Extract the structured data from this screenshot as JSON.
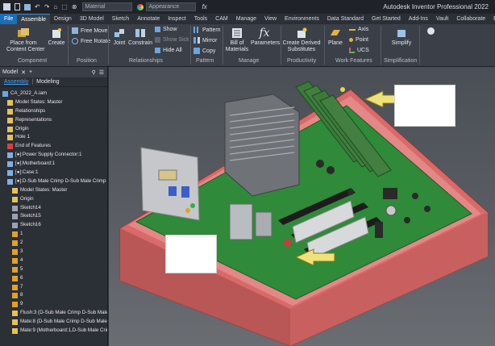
{
  "app": {
    "title": "Autodesk Inventor Professional 2022",
    "material_placeholder": "Material",
    "appearance_placeholder": "Appearance"
  },
  "tabs": [
    "File",
    "Assemble",
    "Design",
    "3D Model",
    "Sketch",
    "Annotate",
    "Inspect",
    "Tools",
    "CAM",
    "Manage",
    "View",
    "Environments",
    "Data Standard",
    "Get Started",
    "Add-Ins",
    "Vault",
    "Collaborate",
    "Ele"
  ],
  "ribbon": {
    "component": {
      "label": "Component",
      "place": "Place from\nContent Center",
      "create": "Create"
    },
    "position": {
      "label": "Position",
      "free_move": "Free Move",
      "free_rotate": "Free Rotate"
    },
    "relationships": {
      "label": "Relationships",
      "joint": "Joint",
      "constrain": "Constrain",
      "show": "Show",
      "show_sick": "Show Sick",
      "hide_all": "Hide All"
    },
    "pattern": {
      "label": "Pattern",
      "pattern": "Pattern",
      "mirror": "Mirror",
      "copy": "Copy"
    },
    "manage": {
      "label": "Manage",
      "bom": "Bill of\nMaterials",
      "parameters": "Parameters"
    },
    "productivity": {
      "label": "Productivity",
      "create_derived": "Create Derived\nSubstitutes"
    },
    "work_features": {
      "label": "Work Features",
      "plane": "Plane",
      "axis": "Axis",
      "point": "Point",
      "ucs": "UCS"
    },
    "simplification": {
      "label": "Simplification",
      "simplify": "Simplify"
    }
  },
  "browser": {
    "tab_model": "Model",
    "subtab_assembly": "Assembly",
    "subtab_modeling": "Modeling",
    "items": [
      "CA_2022_A.iam",
      "Model States: Master",
      "Relationships",
      "Representations",
      "Origin",
      "Hole 1",
      "End of Features",
      "[●]:Power Supply Connector:1",
      "[●]:Motherboard:1",
      "[●]:Case:1",
      "[●]:D-Sub Male Crimp D-Sub Male Crimp 9",
      "Model States: Master",
      "Origin",
      "Sketch14",
      "Sketch15",
      "Sketch16",
      "1",
      "2",
      "3",
      "4",
      "5",
      "6",
      "7",
      "8",
      "9",
      "Flush:3 (D-Sub Male Crimp D-Sub Male",
      "Mate:8 (D-Sub Male Crimp D-Sub Male C",
      "Mate:9 (Motherboard:1,D-Sub Male Crimp"
    ]
  },
  "colors": {
    "accent": "#1a6fb9",
    "board": "#2f8a3a",
    "case": "#d86a6a",
    "arrow": "#f0e27a"
  }
}
